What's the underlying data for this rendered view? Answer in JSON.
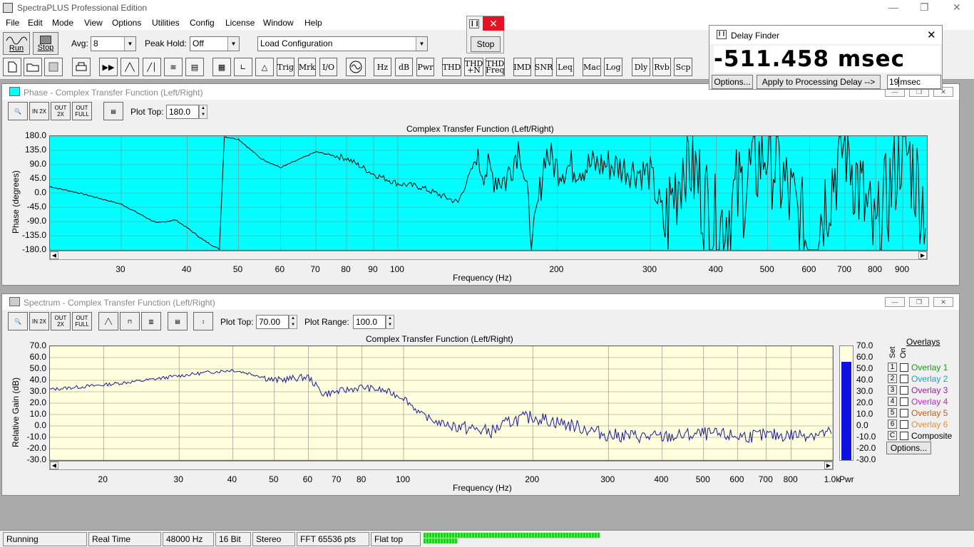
{
  "app": {
    "title": "SpectraPLUS Professional Edition"
  },
  "menu": [
    "File",
    "Edit",
    "Mode",
    "View",
    "Options",
    "Utilities",
    "Config",
    "License",
    "Window",
    "Help"
  ],
  "toolbar": {
    "run_label": "Run",
    "stop_label": "Stop",
    "avg_label": "Avg:",
    "avg_value": "8",
    "peak_hold_label": "Peak Hold:",
    "peak_hold_value": "Off",
    "load_config": "Load Configuration",
    "icon_buttons": [
      "Trig",
      "Mrk",
      "I/O",
      "Hz",
      "dB",
      "Pwr",
      "THD",
      "THD +N",
      "THD Freq",
      "IMD",
      "SNR",
      "Leq",
      "Mac",
      "Log",
      "Dly",
      "Rvb",
      "Scp"
    ]
  },
  "stop_popup": {
    "stop_label": "Stop"
  },
  "delay_finder": {
    "title": "Delay Finder",
    "value": "-511.458 msec",
    "options_label": "Options...",
    "apply_label": "Apply to Processing Delay -->",
    "input_value": "19",
    "input_unit": "msec"
  },
  "phase_window": {
    "title": "Phase - Complex Transfer Function (Left/Right)",
    "plot_top_label": "Plot Top:",
    "plot_top_value": "180.0",
    "chart_title": "Complex Transfer Function (Left/Right)",
    "ylabel": "Phase (degrees)",
    "xlabel": "Frequency (Hz)",
    "yticks": [
      "180.0",
      "135.0",
      "90.0",
      "45.0",
      "0.0",
      "-45.0",
      "-90.0",
      "-135.0",
      "-180.0"
    ],
    "xticks": [
      "30",
      "40",
      "50",
      "60",
      "70",
      "80",
      "90",
      "100",
      "200",
      "300",
      "400",
      "500",
      "600",
      "700",
      "800",
      "900"
    ],
    "zoom_buttons": [
      "IN 2X",
      "OUT 2X",
      "OUT FULL"
    ]
  },
  "spectrum_window": {
    "title": "Spectrum - Complex Transfer Function (Left/Right)",
    "plot_top_label": "Plot Top:",
    "plot_top_value": "70.00",
    "plot_range_label": "Plot Range:",
    "plot_range_value": "100.0",
    "chart_title": "Complex Transfer Function (Left/Right)",
    "ylabel": "Relative Gain (dB)",
    "xlabel": "Frequency (Hz)",
    "yticks": [
      "70.0",
      "60.0",
      "50.0",
      "40.0",
      "30.0",
      "20.0",
      "10.0",
      "0.0",
      "-10.0",
      "-20.0",
      "-30.0"
    ],
    "xticks": [
      "20",
      "30",
      "40",
      "50",
      "60",
      "70",
      "80",
      "100",
      "200",
      "300",
      "400",
      "500",
      "600",
      "700",
      "800",
      "1.0k"
    ],
    "pwr_label": "Pwr",
    "meter_ticks": [
      "70.0",
      "60.0",
      "50.0",
      "40.0",
      "30.0",
      "20.0",
      "10.0",
      "0.0",
      "-10.0",
      "-20.0",
      "-30.0"
    ],
    "overlays": {
      "title": "Overlays",
      "set_label": "Set",
      "on_label": "On",
      "items": [
        {
          "num": "1",
          "label": "Overlay 1",
          "color": "#1a9a1a"
        },
        {
          "num": "2",
          "label": "Overlay 2",
          "color": "#20a0c0"
        },
        {
          "num": "3",
          "label": "Overlay 3",
          "color": "#a020a0"
        },
        {
          "num": "4",
          "label": "Overlay 4",
          "color": "#d020d0"
        },
        {
          "num": "5",
          "label": "Overlay 5",
          "color": "#c06010"
        },
        {
          "num": "6",
          "label": "Overlay 6",
          "color": "#e09040"
        },
        {
          "num": "C",
          "label": "Composite",
          "color": "#000000"
        }
      ],
      "options_label": "Options..."
    }
  },
  "status": {
    "state": "Running",
    "mode": "Real Time",
    "rate": "48000 Hz",
    "bits": "16 Bit",
    "channels": "Stereo",
    "fft": "FFT 65536 pts",
    "window": "Flat top"
  },
  "chart_data": [
    {
      "type": "line",
      "title": "Complex Transfer Function (Left/Right)",
      "xlabel": "Frequency (Hz)",
      "ylabel": "Phase (degrees)",
      "ylim": [
        -180,
        180
      ],
      "xlim": [
        22,
        1000
      ],
      "xscale": "log",
      "background": "#00ffff",
      "series": [
        {
          "x": [
            22,
            25,
            30,
            35,
            38,
            40,
            43,
            46,
            47,
            50,
            55,
            60,
            70,
            80,
            90,
            100,
            110,
            130,
            140,
            150,
            160,
            170,
            180,
            190,
            200,
            250,
            300,
            320,
            350,
            400,
            500,
            600,
            700,
            800,
            900,
            1000
          ],
          "y": [
            20,
            0,
            -35,
            -95,
            -85,
            -110,
            -150,
            -178,
            178,
            170,
            110,
            80,
            130,
            110,
            60,
            30,
            20,
            -30,
            100,
            60,
            40,
            160,
            -160,
            130,
            80,
            90,
            60,
            -100,
            140,
            -120,
            150,
            -170,
            170,
            -160,
            170,
            -60
          ]
        }
      ]
    },
    {
      "type": "line",
      "title": "Complex Transfer Function (Left/Right)",
      "xlabel": "Frequency (Hz)",
      "ylabel": "Relative Gain (dB)",
      "ylim": [
        -30,
        70
      ],
      "xlim": [
        15,
        1000
      ],
      "xscale": "log",
      "background": "#ffffdd",
      "series": [
        {
          "x": [
            15,
            20,
            25,
            30,
            35,
            40,
            45,
            50,
            60,
            65,
            70,
            80,
            90,
            100,
            110,
            120,
            140,
            160,
            180,
            200,
            250,
            300,
            400,
            500,
            600,
            800,
            1000
          ],
          "y": [
            32,
            36,
            40,
            44,
            47,
            49,
            45,
            40,
            43,
            28,
            30,
            34,
            31,
            25,
            10,
            3,
            -2,
            -5,
            5,
            8,
            0,
            -8,
            -10,
            -7,
            -9,
            -8,
            -6
          ]
        }
      ]
    }
  ]
}
